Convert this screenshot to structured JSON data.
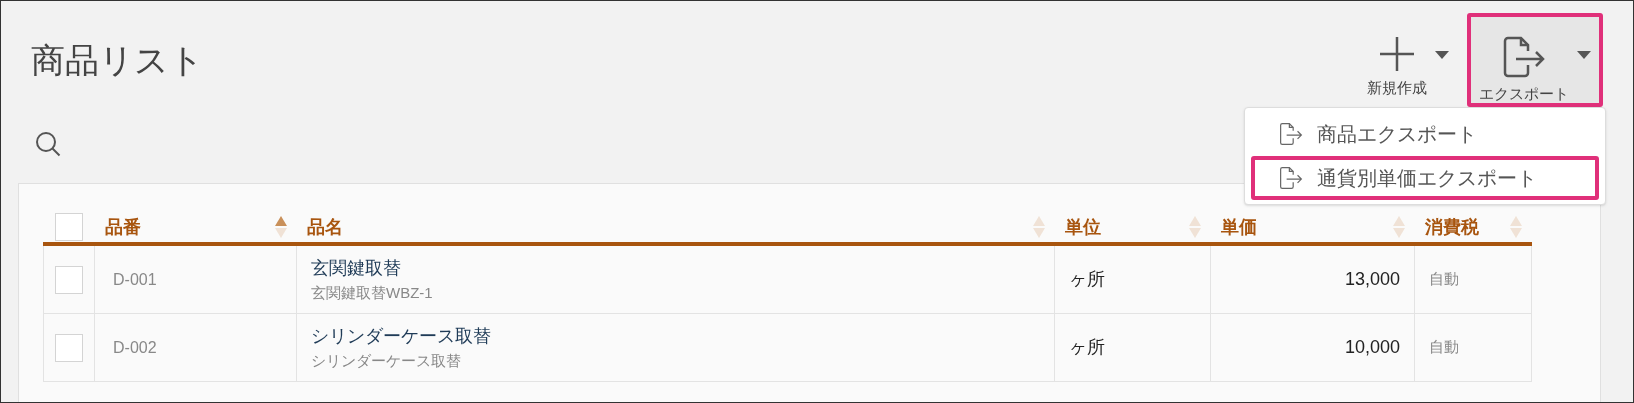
{
  "page_title": "商品リスト",
  "toolbar": [
    {
      "kind": "new",
      "label": "新規作成",
      "highlighted": false
    },
    {
      "kind": "export",
      "label": "エクスポート",
      "highlighted": true
    }
  ],
  "export_menu": [
    {
      "label": "商品エクスポート",
      "highlighted": false
    },
    {
      "label": "通貨別単価エクスポート",
      "highlighted": true
    }
  ],
  "table": {
    "select_all": {
      "checked": false
    },
    "columns": [
      {
        "label": "品番",
        "sorted": true
      },
      {
        "label": "品名",
        "sorted": false
      },
      {
        "label": "単位",
        "sorted": false
      },
      {
        "label": "単価",
        "sorted": false
      },
      {
        "label": "消費税",
        "sorted": false
      }
    ],
    "rows": [
      {
        "checked": false,
        "code": "D-001",
        "name": "玄関鍵取替",
        "subname": "玄関鍵取替WBZ-1",
        "unit": "ヶ所",
        "price": "13,000",
        "tax": "自動"
      },
      {
        "checked": false,
        "code": "D-002",
        "name": "シリンダーケース取替",
        "subname": "シリンダーケース取替",
        "unit": "ヶ所",
        "price": "10,000",
        "tax": "自動"
      }
    ]
  }
}
